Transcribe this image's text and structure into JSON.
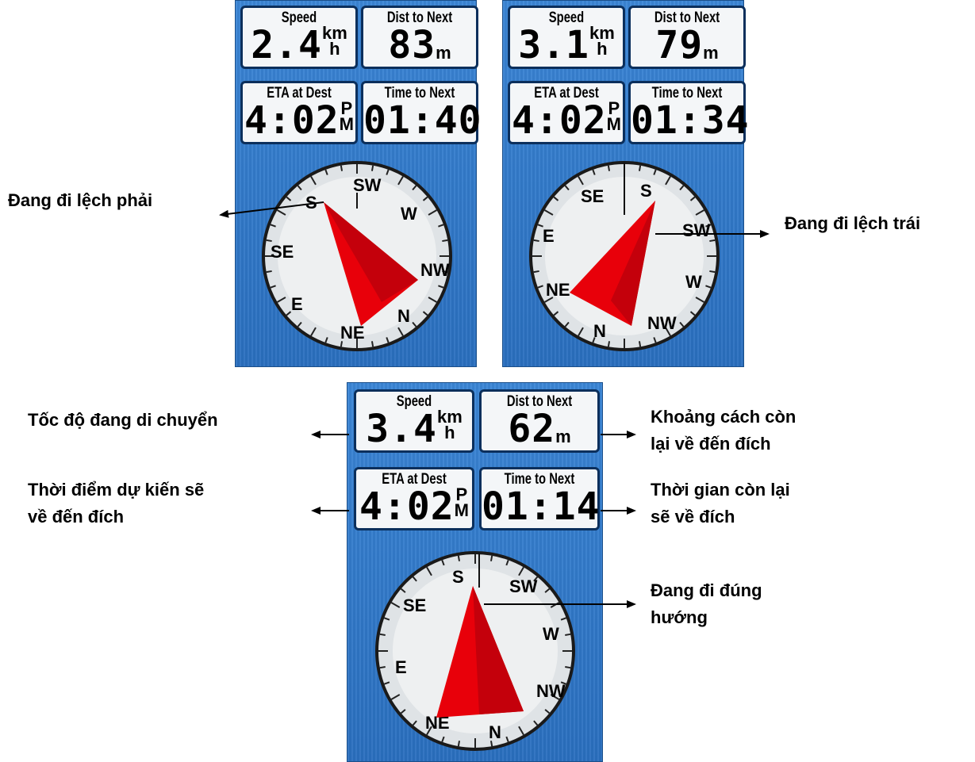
{
  "screens": [
    {
      "speed": {
        "label": "Speed",
        "value": "2.4",
        "unit_top": "km",
        "unit_bottom": "h"
      },
      "dist": {
        "label": "Dist to Next",
        "value": "83",
        "unit": "m"
      },
      "eta": {
        "label": "ETA at Dest",
        "value": "4:02",
        "unit_top": "P",
        "unit_bottom": "M"
      },
      "time": {
        "label": "Time to Next",
        "value": "01:40"
      },
      "compass": {
        "S": "S",
        "SW": "SW",
        "W": "W",
        "NW": "NW",
        "N": "N",
        "NE": "NE",
        "E": "E",
        "SE": "SE"
      }
    },
    {
      "speed": {
        "label": "Speed",
        "value": "3.1",
        "unit_top": "km",
        "unit_bottom": "h"
      },
      "dist": {
        "label": "Dist to Next",
        "value": "79",
        "unit": "m"
      },
      "eta": {
        "label": "ETA at Dest",
        "value": "4:02",
        "unit_top": "P",
        "unit_bottom": "M"
      },
      "time": {
        "label": "Time to Next",
        "value": "01:34"
      },
      "compass": {
        "S": "S",
        "SW": "SW",
        "W": "W",
        "NW": "NW",
        "N": "N",
        "NE": "NE",
        "E": "E",
        "SE": "SE"
      }
    },
    {
      "speed": {
        "label": "Speed",
        "value": "3.4",
        "unit_top": "km",
        "unit_bottom": "h"
      },
      "dist": {
        "label": "Dist to Next",
        "value": "62",
        "unit": "m"
      },
      "eta": {
        "label": "ETA at Dest",
        "value": "4:02",
        "unit_top": "P",
        "unit_bottom": "M"
      },
      "time": {
        "label": "Time to Next",
        "value": "01:14"
      },
      "compass": {
        "S": "S",
        "SW": "SW",
        "W": "W",
        "NW": "NW",
        "N": "N",
        "NE": "NE",
        "E": "E",
        "SE": "SE"
      }
    }
  ],
  "callouts": {
    "right_dev": "Đang đi lệch phải",
    "left_dev": "Đang đi lệch trái",
    "speed_line": "Tốc độ đang di chuyển",
    "dist_line1": "Khoảng cách còn",
    "dist_line2": "lại về đến đích",
    "eta_line1": "Thời điểm dự kiến sẽ",
    "eta_line2": "về đến đích",
    "time_line1": "Thời gian còn lại",
    "time_line2": "sẽ về đích",
    "correct_line1": "Đang đi đúng",
    "correct_line2": "hướng"
  },
  "colors": {
    "panel": "#2f78c7",
    "pointer": "#e8000a",
    "pointer_dark": "#b8000a",
    "field_border": "#0b2f5c"
  }
}
